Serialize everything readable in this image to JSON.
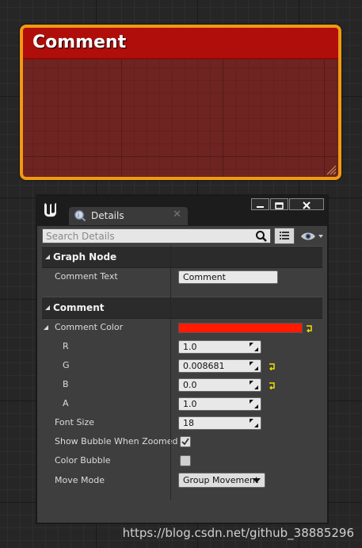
{
  "comment_node": {
    "title": "Comment"
  },
  "details_panel": {
    "tab_label": "Details",
    "tab_close": "✕",
    "search": {
      "placeholder": "Search Details"
    },
    "sections": {
      "graph_node": {
        "title": "Graph Node",
        "comment_text_label": "Comment Text",
        "comment_text_value": "Comment"
      },
      "comment": {
        "title": "Comment",
        "color_label": "Comment Color",
        "color_hex": "#ff1a00",
        "r_label": "R",
        "r_value": "1.0",
        "g_label": "G",
        "g_value": "0.008681",
        "b_label": "B",
        "b_value": "0.0",
        "a_label": "A",
        "a_value": "1.0",
        "font_size_label": "Font Size",
        "font_size_value": "18",
        "show_bubble_label": "Show Bubble When Zoomed",
        "show_bubble_checked": true,
        "color_bubble_label": "Color Bubble",
        "color_bubble_checked": false,
        "move_mode_label": "Move Mode",
        "move_mode_value": "Group Movement"
      }
    }
  },
  "watermark": "https://blog.csdn.net/github_38885296",
  "colors": {
    "comment_border": "#f09a10",
    "comment_header": "#b00e0a",
    "comment_body": "#6e2420",
    "reset_arrow": "#f0e000"
  }
}
